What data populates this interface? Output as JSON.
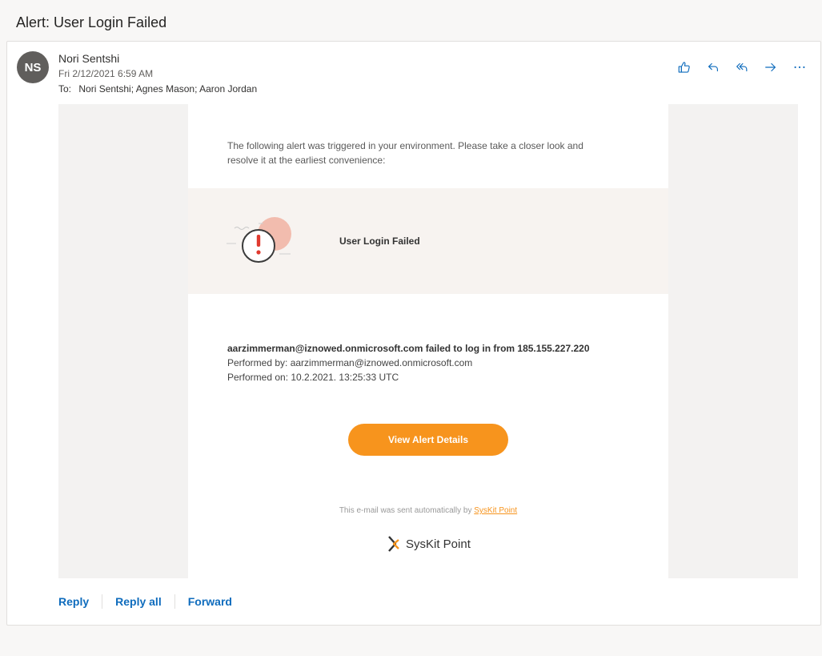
{
  "subject": "Alert: User Login Failed",
  "message": {
    "avatar_initials": "NS",
    "sender": "Nori Sentshi",
    "date": "Fri 2/12/2021 6:59 AM",
    "to_label": "To:",
    "recipients": "Nori Sentshi; Agnes Mason; Aaron Jordan"
  },
  "toolbar_icons": [
    "like-icon",
    "reply-icon",
    "reply-all-icon",
    "forward-icon",
    "more-icon"
  ],
  "email": {
    "intro": "The following alert was triggered in your environment. Please take a closer look and resolve it at the earliest convenience:",
    "alert_title": "User Login Failed",
    "detail_main": "aarzimmerman@iznowed.onmicrosoft.com failed to log in from 185.155.227.220",
    "performed_by": "Performed by: aarzimmerman@iznowed.onmicrosoft.com",
    "performed_on": "Performed on: 10.2.2021. 13:25:33 UTC",
    "cta_label": "View Alert Details",
    "footer_prefix": "This e-mail was sent automatically by ",
    "footer_link": "SysKit Point",
    "logo_text": "SysKit Point"
  },
  "reply_bar": {
    "reply": "Reply",
    "reply_all": "Reply all",
    "forward": "Forward"
  },
  "colors": {
    "accent": "#0f6cbd",
    "cta": "#f7941d",
    "alert_red": "#e03a2f"
  }
}
